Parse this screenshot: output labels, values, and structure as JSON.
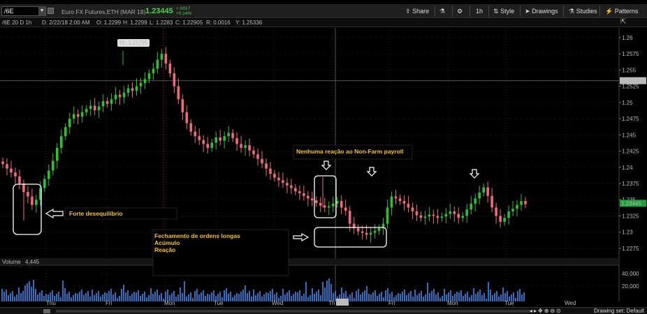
{
  "toolbar": {
    "symbol": "/6E",
    "description": "Euro FX Futures,ETH (MAR 18)",
    "last": "1.23445",
    "change_abs": "+.0017",
    "change_pct": "+0.14%",
    "share": "Share",
    "interval": "1h",
    "style": "Style",
    "drawings": "Drawings",
    "studies": "Studies",
    "patterns": "Patterns"
  },
  "infobar": {
    "chart_id": "/6E 20 D 1h",
    "date": "D: 2/22/18 2:00 AM",
    "open": "O: 1.2299",
    "high": "H: 1.2299",
    "low": "L: 1.2283",
    "close": "C: 1.22905",
    "range": "R: 0.0016",
    "y": "Y: 1.25336"
  },
  "price_axis": {
    "ticks": [
      "1.26",
      "1.2575",
      "1.255",
      "1.2525",
      "1.25",
      "1.2475",
      "1.245",
      "1.2425",
      "1.24",
      "1.2375",
      "1.235",
      "1.2325",
      "1.23",
      "1.2275"
    ],
    "cursor_label": "1.25336",
    "last_label": "1.23445"
  },
  "volume": {
    "label": "Volume",
    "value": "4,445",
    "ticks": [
      "40,000",
      "20,000"
    ]
  },
  "time_axis": {
    "labels": [
      "Thu",
      "Fri",
      "Mon",
      "Tue",
      "Wed",
      "Th",
      "2:00",
      "Fri",
      "Mon",
      "Tue",
      "Wed"
    ]
  },
  "annotations": {
    "high_label": "Hi: 1.25795",
    "forte": "Forte desequilíbrio",
    "nonfarm": "Nenhuma reação ao Non-Farm payroll",
    "fechamento_1": "Fechamento de ordens longas",
    "fechamento_2": "Acúmulo",
    "fechamento_3": "Reação"
  },
  "bottombar": {
    "drawing_set": "Drawing set: Default"
  },
  "colors": {
    "up": "#2fbf2f",
    "down": "#ef6b7a",
    "volume": "#2f6fbf",
    "annotation_text": "#f5c518",
    "last_price_bg": "#1f9e3a"
  },
  "chart_data": {
    "type": "candlestick",
    "ylim": [
      1.2262,
      1.2615
    ],
    "series": [
      {
        "name": "Price",
        "values": [
          1.2405,
          1.2398,
          1.2392,
          1.2386,
          1.2375,
          1.2362,
          1.2355,
          1.2342,
          1.235,
          1.2368,
          1.2382,
          1.2395,
          1.241,
          1.243,
          1.2448,
          1.2462,
          1.2475,
          1.2482,
          1.2478,
          1.2485,
          1.249,
          1.2495,
          1.2488,
          1.2494,
          1.2502,
          1.2498,
          1.2505,
          1.2512,
          1.2508,
          1.2515,
          1.2522,
          1.2518,
          1.2525,
          1.253,
          1.2536,
          1.2545,
          1.2552,
          1.2566,
          1.2575,
          1.256,
          1.2545,
          1.2525,
          1.2505,
          1.2485,
          1.2468,
          1.2455,
          1.2448,
          1.2442,
          1.2436,
          1.243,
          1.2438,
          1.2446,
          1.2441,
          1.2448,
          1.2453,
          1.2445,
          1.2436,
          1.243,
          1.2434,
          1.2426,
          1.242,
          1.2413,
          1.2406,
          1.2398,
          1.239,
          1.2384,
          1.238,
          1.2376,
          1.2372,
          1.2368,
          1.2363,
          1.236,
          1.2356,
          1.2352,
          1.2349,
          1.2345,
          1.2341,
          1.2338,
          1.234,
          1.2344,
          1.2348,
          1.2338,
          1.2333,
          1.2313,
          1.2306,
          1.2301,
          1.2299,
          1.2296,
          1.2299,
          1.2302,
          1.2306,
          1.2313,
          1.2338,
          1.2355,
          1.2352,
          1.2348,
          1.2344,
          1.2338,
          1.2332,
          1.2326,
          1.2322,
          1.2324,
          1.2327,
          1.2325,
          1.2322,
          1.2324,
          1.2328,
          1.2332,
          1.2328,
          1.2322,
          1.2325,
          1.2335,
          1.2344,
          1.2352,
          1.2361,
          1.2369,
          1.2356,
          1.2338,
          1.2325,
          1.2316,
          1.2322,
          1.2332,
          1.2336,
          1.2342,
          1.2348,
          1.2343
        ]
      }
    ]
  }
}
